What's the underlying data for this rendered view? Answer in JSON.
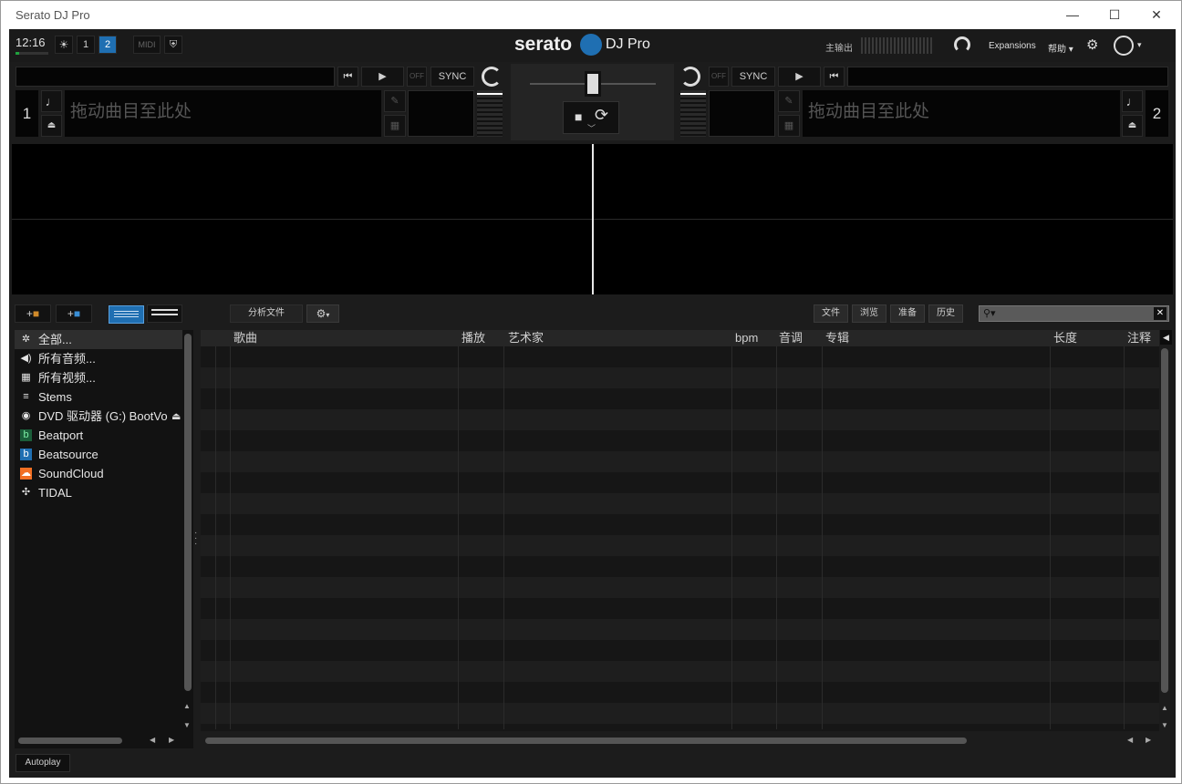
{
  "window": {
    "title": "Serato DJ Pro",
    "min": "—",
    "max": "☐",
    "close": "✕"
  },
  "topbar": {
    "time": "12:16",
    "deck_btn_1": "1",
    "deck_btn_2": "2",
    "midi": "MIDI",
    "logo_text": "serato",
    "logo_product": "DJ Pro",
    "master_out": "主输出",
    "expansions": "Expansions",
    "help": "帮助",
    "colors": {
      "accent": "#1f6fb2",
      "green": "#1fa13d"
    }
  },
  "deck1": {
    "number": "1",
    "drop_text": "拖动曲目至此处",
    "off": "OFF",
    "sync": "SYNC"
  },
  "deck2": {
    "number": "2",
    "drop_text": "拖动曲目至此处",
    "off": "OFF",
    "sync": "SYNC"
  },
  "library_toolbar": {
    "analyze": "分析文件",
    "tabs": [
      "文件",
      "浏览",
      "准备",
      "历史"
    ]
  },
  "sidebar": {
    "items": [
      {
        "label": "全部...",
        "icon": "crate-all-icon"
      },
      {
        "label": "所有音频...",
        "icon": "speaker-icon"
      },
      {
        "label": "所有视频...",
        "icon": "film-icon"
      },
      {
        "label": "Stems",
        "icon": "stems-icon"
      },
      {
        "label": "DVD 驱动器 (G:) BootVo",
        "icon": "disc-icon"
      },
      {
        "label": "Beatport",
        "icon": "beatport-icon"
      },
      {
        "label": "Beatsource",
        "icon": "beatsource-icon"
      },
      {
        "label": "SoundCloud",
        "icon": "soundcloud-icon"
      },
      {
        "label": "TIDAL",
        "icon": "tidal-icon"
      }
    ]
  },
  "table": {
    "columns": [
      "歌曲",
      "播放",
      "艺术家",
      "bpm",
      "音调",
      "专辑",
      "长度",
      "注释"
    ]
  },
  "footer": {
    "autoplay": "Autoplay"
  }
}
